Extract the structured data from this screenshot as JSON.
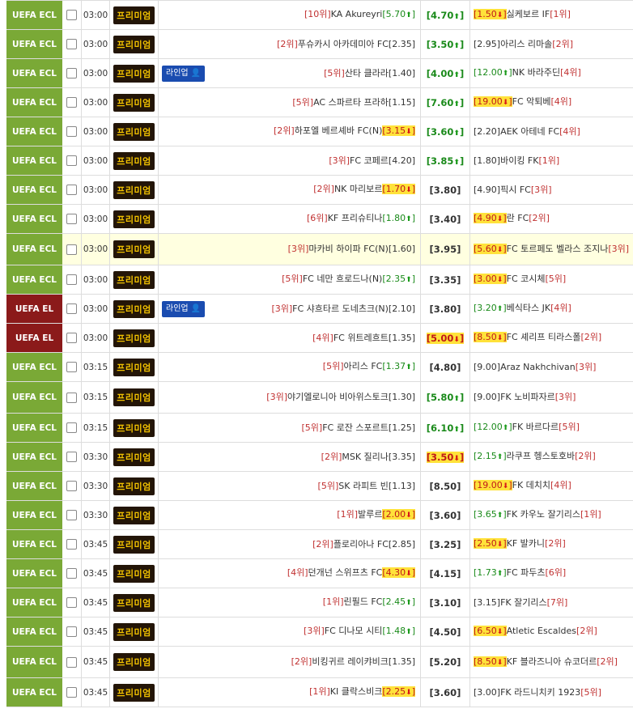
{
  "labels": {
    "premium": "프리미엄",
    "lineup": "라인업"
  },
  "colors": {
    "ecl": "#7aa936",
    "el": "#8b1a1a",
    "premium_bg": "#231507",
    "premium_fg": "#f2c200",
    "lineup_bg": "#1a4cb0"
  },
  "rows": [
    {
      "league": "UEFA ECL",
      "lg": "ecl",
      "time": "03:00",
      "lineup": false,
      "h": 36,
      "hl": false,
      "home": {
        "rank": "[10위]",
        "team": "KA Akureyri",
        "odds": "[5.70",
        "mv": "up"
      },
      "draw": {
        "odds": "[4.70",
        "mv": "up"
      },
      "away": {
        "rank": "[1위]",
        "team": "싫케보르 IF",
        "odds": "[1.50",
        "mv": "dn"
      }
    },
    {
      "league": "UEFA ECL",
      "lg": "ecl",
      "time": "03:00",
      "lineup": false,
      "h": 36,
      "hl": false,
      "home": {
        "rank": "[2위]",
        "team": "푸슈카시 아카데미아 FC",
        "odds": "[2.35]",
        "mv": ""
      },
      "draw": {
        "odds": "[3.50",
        "mv": "up"
      },
      "away": {
        "rank": "[2위]",
        "team": "아리스 리마솔",
        "odds": "[2.95]",
        "mv": ""
      }
    },
    {
      "league": "UEFA ECL",
      "lg": "ecl",
      "time": "03:00",
      "lineup": true,
      "h": 36,
      "hl": false,
      "home": {
        "rank": "[5위]",
        "team": "산타 클라라",
        "odds": "[1.40]",
        "mv": ""
      },
      "draw": {
        "odds": "[4.00",
        "mv": "up"
      },
      "away": {
        "rank": "[4위]",
        "team": "NK 바라주딘",
        "odds": "[12.00",
        "mv": "up"
      }
    },
    {
      "league": "UEFA ECL",
      "lg": "ecl",
      "time": "03:00",
      "lineup": false,
      "h": 36,
      "hl": false,
      "home": {
        "rank": "[5위]",
        "team": "AC 스파르타 프라하",
        "odds": "[1.15]",
        "mv": ""
      },
      "draw": {
        "odds": "[7.60",
        "mv": "up"
      },
      "away": {
        "rank": "[4위]",
        "team": "FC 악퇴베",
        "odds": "[19.00",
        "mv": "dn"
      }
    },
    {
      "league": "UEFA ECL",
      "lg": "ecl",
      "time": "03:00",
      "lineup": false,
      "h": 36,
      "hl": false,
      "home": {
        "rank": "[2위]",
        "team": "하포엘 베르셰바 FC(N)",
        "odds": "[3.15",
        "mv": "dn"
      },
      "draw": {
        "odds": "[3.60",
        "mv": "up"
      },
      "away": {
        "rank": "[4위]",
        "team": "AEK 아테네 FC",
        "odds": "[2.20]",
        "mv": ""
      }
    },
    {
      "league": "UEFA ECL",
      "lg": "ecl",
      "time": "03:00",
      "lineup": false,
      "h": 36,
      "hl": false,
      "home": {
        "rank": "[3위]",
        "team": "FC 코페르",
        "odds": "[4.20]",
        "mv": ""
      },
      "draw": {
        "odds": "[3.85",
        "mv": "up"
      },
      "away": {
        "rank": "[1위]",
        "team": "바이킹 FK",
        "odds": "[1.80]",
        "mv": ""
      }
    },
    {
      "league": "UEFA ECL",
      "lg": "ecl",
      "time": "03:00",
      "lineup": false,
      "h": 36,
      "hl": false,
      "home": {
        "rank": "[2위]",
        "team": "NK 마리보르",
        "odds": "[1.70",
        "mv": "dn"
      },
      "draw": {
        "odds": "[3.80]",
        "mv": ""
      },
      "away": {
        "rank": "[3위]",
        "team": "픽시 FC",
        "odds": "[4.90]",
        "mv": ""
      }
    },
    {
      "league": "UEFA ECL",
      "lg": "ecl",
      "time": "03:00",
      "lineup": false,
      "h": 36,
      "hl": false,
      "home": {
        "rank": "[6위]",
        "team": "KF 프리슈티나",
        "odds": "[1.80",
        "mv": "up"
      },
      "draw": {
        "odds": "[3.40]",
        "mv": ""
      },
      "away": {
        "rank": "[2위]",
        "team": "란 FC",
        "odds": "[4.90",
        "mv": "dn"
      }
    },
    {
      "league": "UEFA ECL",
      "lg": "ecl",
      "time": "03:00",
      "lineup": false,
      "h": 39,
      "hl": true,
      "home": {
        "rank": "[3위]",
        "team": "마카비 하이파 FC(N)",
        "odds": "[1.60]",
        "mv": ""
      },
      "draw": {
        "odds": "[3.95]",
        "mv": ""
      },
      "away": {
        "rank": "[3위]",
        "team": "FC 토르페도 벨라스 조지나",
        "odds": "[5.60",
        "mv": "dn"
      }
    },
    {
      "league": "UEFA ECL",
      "lg": "ecl",
      "time": "03:00",
      "lineup": false,
      "h": 36,
      "hl": false,
      "home": {
        "rank": "[5위]",
        "team": "FC 네만 흐로드나(N)",
        "odds": "[2.35",
        "mv": "up"
      },
      "draw": {
        "odds": "[3.35]",
        "mv": ""
      },
      "away": {
        "rank": "[5위]",
        "team": "FC 코시체",
        "odds": "[3.00",
        "mv": "dn"
      }
    },
    {
      "league": "UEFA EL",
      "lg": "el",
      "time": "03:00",
      "lineup": true,
      "h": 36,
      "hl": false,
      "home": {
        "rank": "[3위]",
        "team": "FC 샤흐타르 도네츠크(N)",
        "odds": "[2.10]",
        "mv": ""
      },
      "draw": {
        "odds": "[3.80]",
        "mv": ""
      },
      "away": {
        "rank": "[4위]",
        "team": "베식타스 JK",
        "odds": "[3.20",
        "mv": "up"
      }
    },
    {
      "league": "UEFA EL",
      "lg": "el",
      "time": "03:00",
      "lineup": false,
      "h": 36,
      "hl": false,
      "home": {
        "rank": "[4위]",
        "team": "FC 위트레흐트",
        "odds": "[1.35]",
        "mv": ""
      },
      "draw": {
        "odds": "[5.00",
        "mv": "dn"
      },
      "away": {
        "rank": "[2위]",
        "team": "FC 셰리프 티라스폴",
        "odds": "[8.50",
        "mv": "dn"
      }
    },
    {
      "league": "UEFA ECL",
      "lg": "ecl",
      "time": "03:15",
      "lineup": false,
      "h": 36,
      "hl": false,
      "home": {
        "rank": "[5위]",
        "team": "아리스 FC",
        "odds": "[1.37",
        "mv": "up"
      },
      "draw": {
        "odds": "[4.80]",
        "mv": ""
      },
      "away": {
        "rank": "[3위]",
        "team": "Araz Nakhchivan",
        "odds": "[9.00]",
        "mv": ""
      }
    },
    {
      "league": "UEFA ECL",
      "lg": "ecl",
      "time": "03:15",
      "lineup": false,
      "h": 39,
      "hl": false,
      "home": {
        "rank": "[3위]",
        "team": "야기엘로니아 비아위스토크",
        "odds": "[1.30]",
        "mv": ""
      },
      "draw": {
        "odds": "[5.80",
        "mv": "up"
      },
      "away": {
        "rank": "[3위]",
        "team": "FK 노비파자르",
        "odds": "[9.00]",
        "mv": ""
      }
    },
    {
      "league": "UEFA ECL",
      "lg": "ecl",
      "time": "03:15",
      "lineup": false,
      "h": 36,
      "hl": false,
      "home": {
        "rank": "[5위]",
        "team": "FC 로잔 스포르트",
        "odds": "[1.25]",
        "mv": ""
      },
      "draw": {
        "odds": "[6.10",
        "mv": "up"
      },
      "away": {
        "rank": "[5위]",
        "team": "FK 바르다르",
        "odds": "[12.00",
        "mv": "up"
      }
    },
    {
      "league": "UEFA ECL",
      "lg": "ecl",
      "time": "03:30",
      "lineup": false,
      "h": 36,
      "hl": false,
      "home": {
        "rank": "[2위]",
        "team": "MSK 질리나",
        "odds": "[3.35]",
        "mv": ""
      },
      "draw": {
        "odds": "[3.50",
        "mv": "dn"
      },
      "away": {
        "rank": "[2위]",
        "team": "라쿠프 헹스토호바",
        "odds": "[2.15",
        "mv": "up"
      }
    },
    {
      "league": "UEFA ECL",
      "lg": "ecl",
      "time": "03:30",
      "lineup": false,
      "h": 36,
      "hl": false,
      "home": {
        "rank": "[5위]",
        "team": "SK 라피트 빈",
        "odds": "[1.13]",
        "mv": ""
      },
      "draw": {
        "odds": "[8.50]",
        "mv": ""
      },
      "away": {
        "rank": "[4위]",
        "team": "FK 데치치",
        "odds": "[19.00",
        "mv": "dn"
      }
    },
    {
      "league": "UEFA ECL",
      "lg": "ecl",
      "time": "03:30",
      "lineup": false,
      "h": 36,
      "hl": false,
      "home": {
        "rank": "[1위]",
        "team": "발루르",
        "odds": "[2.00",
        "mv": "dn"
      },
      "draw": {
        "odds": "[3.60]",
        "mv": ""
      },
      "away": {
        "rank": "[1위]",
        "team": "FK 카우노 잘기리스",
        "odds": "[3.65",
        "mv": "up"
      }
    },
    {
      "league": "UEFA ECL",
      "lg": "ecl",
      "time": "03:45",
      "lineup": false,
      "h": 36,
      "hl": false,
      "home": {
        "rank": "[2위]",
        "team": "플로리아나 FC",
        "odds": "[2.85]",
        "mv": ""
      },
      "draw": {
        "odds": "[3.25]",
        "mv": ""
      },
      "away": {
        "rank": "[2위]",
        "team": "KF 발카니",
        "odds": "[2.50",
        "mv": "dn"
      }
    },
    {
      "league": "UEFA ECL",
      "lg": "ecl",
      "time": "03:45",
      "lineup": false,
      "h": 36,
      "hl": false,
      "home": {
        "rank": "[4위]",
        "team": "던개넌 스위프츠 FC",
        "odds": "[4.30",
        "mv": "dn"
      },
      "draw": {
        "odds": "[4.15]",
        "mv": ""
      },
      "away": {
        "rank": "[6위]",
        "team": "FC 파두츠",
        "odds": "[1.73",
        "mv": "up"
      }
    },
    {
      "league": "UEFA ECL",
      "lg": "ecl",
      "time": "03:45",
      "lineup": false,
      "h": 36,
      "hl": false,
      "home": {
        "rank": "[1위]",
        "team": "린필드 FC",
        "odds": "[2.45",
        "mv": "up"
      },
      "draw": {
        "odds": "[3.10]",
        "mv": ""
      },
      "away": {
        "rank": "[7위]",
        "team": "FK 잘기리스",
        "odds": "[3.15]",
        "mv": ""
      }
    },
    {
      "league": "UEFA ECL",
      "lg": "ecl",
      "time": "03:45",
      "lineup": false,
      "h": 36,
      "hl": false,
      "home": {
        "rank": "[3위]",
        "team": "FC 디나모 시티",
        "odds": "[1.48",
        "mv": "up"
      },
      "draw": {
        "odds": "[4.50]",
        "mv": ""
      },
      "away": {
        "rank": "[2위]",
        "team": "Atletic Escaldes",
        "odds": "[6.50",
        "mv": "dn"
      }
    },
    {
      "league": "UEFA ECL",
      "lg": "ecl",
      "time": "03:45",
      "lineup": false,
      "h": 39,
      "hl": false,
      "home": {
        "rank": "[2위]",
        "team": "비킹귀르 레이캬비크",
        "odds": "[1.35]",
        "mv": ""
      },
      "draw": {
        "odds": "[5.20]",
        "mv": ""
      },
      "away": {
        "rank": "[2위]",
        "team": "KF 블라즈니아 슈코더르",
        "odds": "[8.50",
        "mv": "dn"
      }
    },
    {
      "league": "UEFA ECL",
      "lg": "ecl",
      "time": "03:45",
      "lineup": false,
      "h": 36,
      "hl": false,
      "home": {
        "rank": "[1위]",
        "team": "KI 클락스비크",
        "odds": "[2.25",
        "mv": "dn"
      },
      "draw": {
        "odds": "[3.60]",
        "mv": ""
      },
      "away": {
        "rank": "[5위]",
        "team": "FK 라드니치키 1923",
        "odds": "[3.00]",
        "mv": ""
      }
    }
  ]
}
